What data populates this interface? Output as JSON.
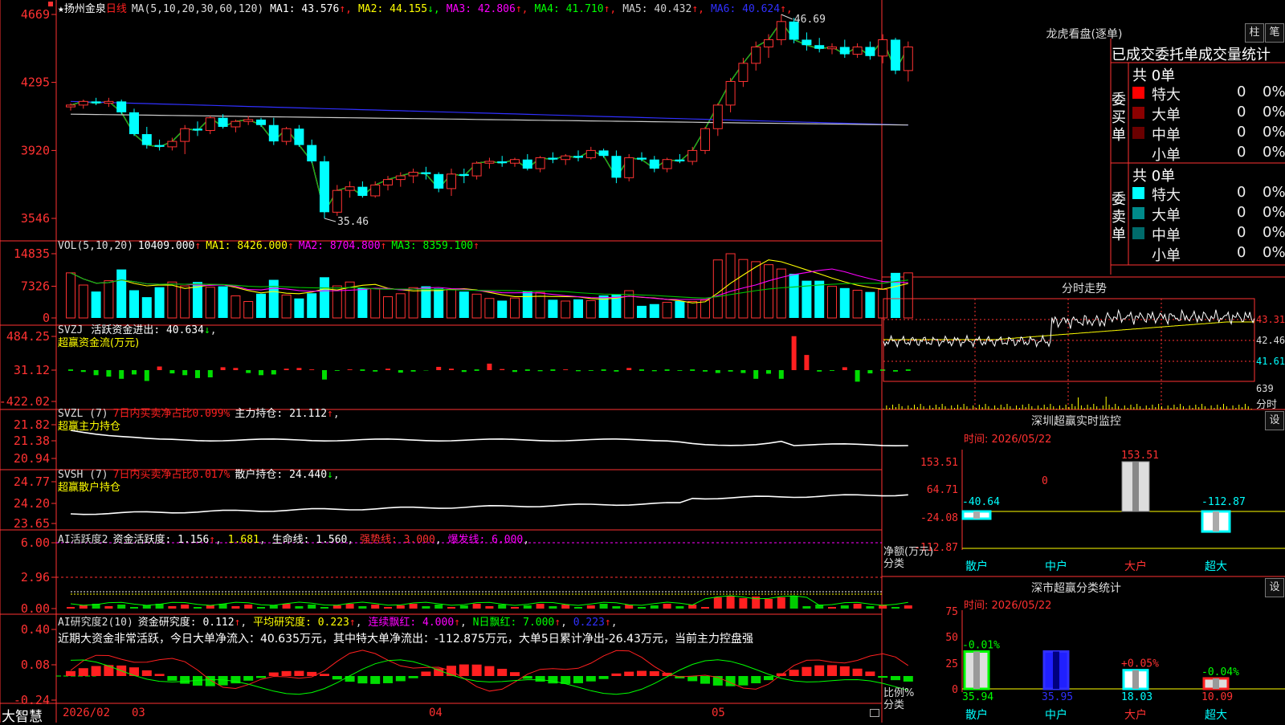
{
  "stock": {
    "star": "★",
    "name": "扬州金泉",
    "period": "日线"
  },
  "price_panel": {
    "ma_label": "MA(5,10,20,30,60,120)",
    "mas": [
      {
        "text": "MA1: 43.576",
        "arrow": "↑",
        "color": "#ffffff"
      },
      {
        "text": "MA2: 44.155",
        "arrow": "↓",
        "color": "#ffff00"
      },
      {
        "text": "MA3: 42.806",
        "arrow": "↑",
        "color": "#ff00ff"
      },
      {
        "text": "MA4: 41.710",
        "arrow": "↑",
        "color": "#00ff00"
      },
      {
        "text": "MA5: 40.432",
        "arrow": "↑",
        "color": "#d0d0d0"
      },
      {
        "text": "MA6: 40.624",
        "arrow": "↑",
        "color": "#3030ff"
      }
    ],
    "yticks": [
      "4669",
      "4295",
      "3920",
      "3546"
    ],
    "high_label": "46.69",
    "low_label": "35.46"
  },
  "vol_panel": {
    "label": "VOL(5,10,20)",
    "value": "10409.000",
    "v_arrow": "↑",
    "ma1": "MA1: 8426.000",
    "ma1_arrow": "↑",
    "ma2": "MA2: 8704.800",
    "ma2_arrow": "↑",
    "ma3": "MA3: 8359.100",
    "ma3_arrow": "↑",
    "yticks": [
      "14835",
      "7326",
      "0"
    ]
  },
  "svzj_panel": {
    "label": "SVZJ",
    "text1": "活跃资金进出: 40.634",
    "arrow": "↓",
    "text2": "超赢资金流(万元)",
    "yticks": [
      "484.25",
      "31.12",
      "-422.02"
    ]
  },
  "svzl_panel": {
    "label": "SVZL (7)",
    "text1": "7日内买卖净占比0.099%",
    "text2": "主力持仓: 21.112",
    "arrow": "↑",
    "text3": "超赢主力持仓",
    "yticks": [
      "21.82",
      "21.38",
      "20.94"
    ]
  },
  "svsh_panel": {
    "label": "SVSH (7)",
    "text1": "7日内买卖净占比0.017%",
    "text2": "散户持仓: 24.440",
    "arrow": "↓",
    "text3": "超赢散户持仓",
    "yticks": [
      "24.77",
      "24.20",
      "23.65"
    ]
  },
  "ai1_panel": {
    "label": "AI活跃度2",
    "text1": "资金活跃度: 1.156",
    "a1": "↑",
    "text2": "1.681",
    "text3": "生命线: 1.560",
    "text4": "强势线: 3.000",
    "text5": "爆发线: 6.000",
    "yticks": [
      "6.00",
      "2.96",
      "0.00"
    ]
  },
  "ai2_panel": {
    "label": "AI研究度2(10)",
    "text1": "资金研究度: 0.112",
    "a1": "↑",
    "text2": "平均研究度: 0.223",
    "a2": "↑",
    "text3": "连续飘红: 4.000",
    "a3": "↑",
    "text4": "N日飘红: 7.000",
    "a4": "↑",
    "text5": "0.223",
    "a5": "↑",
    "summary": "近期大资金非常活跃，今日大单净流入：40.635万元，其中特大单净流出：-112.875万元，大单5日累计净出-26.43万元，当前主力控盘强",
    "yticks": [
      "0.40",
      "0.08",
      "-0.24"
    ]
  },
  "footer": {
    "brand": "大智慧",
    "dates": [
      "2026/02",
      "03",
      "04",
      "05"
    ]
  },
  "dragon_tiger": {
    "title": "龙虎看盘(逐单)",
    "btn1": "柱",
    "btn2": "笔",
    "subtitle": "已成交委托单成交量统计",
    "buy_label": "委买单",
    "sell_label": "委卖单",
    "buy_total": "共 0单",
    "sell_total": "共 0单",
    "buy_rows": [
      {
        "name": "特大",
        "count": "0",
        "pct": "0%",
        "color": "#ff0000"
      },
      {
        "name": "大单",
        "count": "0",
        "pct": "0%",
        "color": "#8b0000"
      },
      {
        "name": "中单",
        "count": "0",
        "pct": "0%",
        "color": "#6a0000"
      },
      {
        "name": "小单",
        "count": "0",
        "pct": "0%",
        "color": "#000000"
      }
    ],
    "sell_rows": [
      {
        "name": "特大",
        "count": "0",
        "pct": "0%",
        "color": "#00ffff"
      },
      {
        "name": "大单",
        "count": "0",
        "pct": "0%",
        "color": "#008b8b"
      },
      {
        "name": "中单",
        "count": "0",
        "pct": "0%",
        "color": "#006b6b"
      },
      {
        "name": "小单",
        "count": "0",
        "pct": "0%",
        "color": "#000000"
      }
    ]
  },
  "intraday": {
    "title": "分时走势",
    "yticks": [
      "43.31",
      "42.46",
      "41.61"
    ],
    "vol_tick": "639",
    "x_label": "分时"
  },
  "monitor": {
    "title": "深圳超赢实时监控",
    "btn": "设",
    "time": "时间: 2026/05/22",
    "yticks": [
      "153.51",
      "64.71",
      "-24.08",
      "-112.87"
    ],
    "ylabel1": "净额(万元)",
    "ylabel2": "分类",
    "cats": [
      "散户",
      "中户",
      "大户",
      "超大"
    ],
    "values": [
      -40.64,
      0,
      153.51,
      -112.87
    ],
    "value_labels": [
      "-40.64",
      "0",
      "153.51",
      "-112.87"
    ]
  },
  "classify": {
    "title": "深市超赢分类统计",
    "btn": "设",
    "time": "时间: 2026/05/22",
    "yticks": [
      "75",
      "50",
      "25",
      "0"
    ],
    "ylabel1": "比例%",
    "ylabel2": "分类",
    "cats": [
      "散户",
      "中户",
      "大户",
      "超大"
    ],
    "values": [
      35.94,
      35.95,
      18.03,
      10.09
    ],
    "value_labels": [
      "35.94",
      "35.95",
      "18.03",
      "10.09"
    ],
    "change_labels": [
      "-0.01%",
      "",
      "+0.05%",
      "-0.04%"
    ]
  },
  "chart_data": {
    "type": "candlestick",
    "price_range": [
      35.46,
      46.69
    ],
    "candles": [
      [
        41.6,
        41.8,
        41.4,
        41.7
      ],
      [
        41.7,
        42.0,
        41.5,
        41.9
      ],
      [
        41.9,
        42.1,
        41.7,
        41.8
      ],
      [
        41.8,
        42.1,
        41.6,
        41.9
      ],
      [
        41.9,
        42.0,
        41.2,
        41.3
      ],
      [
        41.3,
        41.5,
        40.0,
        40.1
      ],
      [
        40.1,
        40.5,
        39.3,
        39.5
      ],
      [
        39.5,
        39.8,
        39.2,
        39.4
      ],
      [
        39.4,
        39.9,
        39.2,
        39.7
      ],
      [
        39.7,
        40.6,
        39.0,
        40.4
      ],
      [
        40.4,
        40.8,
        40.0,
        40.3
      ],
      [
        40.3,
        41.1,
        40.1,
        41.0
      ],
      [
        41.0,
        41.2,
        40.4,
        40.5
      ],
      [
        40.5,
        40.9,
        40.2,
        40.8
      ],
      [
        40.8,
        41.1,
        40.6,
        40.9
      ],
      [
        40.9,
        41.0,
        40.5,
        40.6
      ],
      [
        40.6,
        41.0,
        39.5,
        39.7
      ],
      [
        39.7,
        40.5,
        39.5,
        40.4
      ],
      [
        40.4,
        40.6,
        39.4,
        39.5
      ],
      [
        39.5,
        39.8,
        38.5,
        38.6
      ],
      [
        38.6,
        38.9,
        35.46,
        35.8
      ],
      [
        35.8,
        37.3,
        35.6,
        37.0
      ],
      [
        37.0,
        37.5,
        36.6,
        37.2
      ],
      [
        37.2,
        37.5,
        36.6,
        36.7
      ],
      [
        36.7,
        37.5,
        36.6,
        37.3
      ],
      [
        37.3,
        37.8,
        37.0,
        37.6
      ],
      [
        37.6,
        38.0,
        37.2,
        37.8
      ],
      [
        37.8,
        38.2,
        37.4,
        38.0
      ],
      [
        38.0,
        38.3,
        37.6,
        37.9
      ],
      [
        37.9,
        38.0,
        36.9,
        37.1
      ],
      [
        37.1,
        38.2,
        36.7,
        37.9
      ],
      [
        37.9,
        38.2,
        37.4,
        37.8
      ],
      [
        37.8,
        38.6,
        37.6,
        38.5
      ],
      [
        38.5,
        38.8,
        38.2,
        38.6
      ],
      [
        38.6,
        38.9,
        38.3,
        38.5
      ],
      [
        38.5,
        38.8,
        38.3,
        38.7
      ],
      [
        38.7,
        39.0,
        38.1,
        38.2
      ],
      [
        38.2,
        38.9,
        38.0,
        38.8
      ],
      [
        38.8,
        39.1,
        38.5,
        38.7
      ],
      [
        38.7,
        39.0,
        38.4,
        38.9
      ],
      [
        38.9,
        39.2,
        38.6,
        38.8
      ],
      [
        38.8,
        39.4,
        38.7,
        39.2
      ],
      [
        39.2,
        39.3,
        38.8,
        38.9
      ],
      [
        38.9,
        39.2,
        37.4,
        37.7
      ],
      [
        37.7,
        39.0,
        37.5,
        38.8
      ],
      [
        38.8,
        39.1,
        38.6,
        38.7
      ],
      [
        38.7,
        38.9,
        38.0,
        38.2
      ],
      [
        38.2,
        38.8,
        38.0,
        38.7
      ],
      [
        38.7,
        39.0,
        38.5,
        38.6
      ],
      [
        38.6,
        39.4,
        38.4,
        39.2
      ],
      [
        39.2,
        40.5,
        39.0,
        40.4
      ],
      [
        40.4,
        41.8,
        40.0,
        41.7
      ],
      [
        41.7,
        43.2,
        41.3,
        43.0
      ],
      [
        43.0,
        44.3,
        42.7,
        44.0
      ],
      [
        44.0,
        45.2,
        43.6,
        44.9
      ],
      [
        44.9,
        45.6,
        44.3,
        45.3
      ],
      [
        45.3,
        46.69,
        45.0,
        46.3
      ],
      [
        46.3,
        46.5,
        45.1,
        45.3
      ],
      [
        45.3,
        45.7,
        44.7,
        45.0
      ],
      [
        45.0,
        45.4,
        44.6,
        44.8
      ],
      [
        44.8,
        45.1,
        44.5,
        44.9
      ],
      [
        44.9,
        45.3,
        44.3,
        44.5
      ],
      [
        44.5,
        45.1,
        44.3,
        44.9
      ],
      [
        44.9,
        45.2,
        44.2,
        44.4
      ],
      [
        44.4,
        45.6,
        44.0,
        45.3
      ],
      [
        45.3,
        45.4,
        43.4,
        43.6
      ],
      [
        43.6,
        45.2,
        43.0,
        44.9
      ]
    ],
    "volume": [
      10409,
      7600,
      6100,
      8600,
      11200,
      6400,
      4800,
      7100,
      8300,
      7400,
      8300,
      7100,
      7300,
      5100,
      3800,
      5600,
      8800,
      5300,
      4500,
      5700,
      9400,
      7400,
      8300,
      6900,
      6800,
      4900,
      5600,
      7000,
      7300,
      6800,
      6600,
      6100,
      5500,
      4500,
      4000,
      4600,
      6100,
      5900,
      4200,
      3900,
      4300,
      4000,
      5200,
      5500,
      6300,
      2800,
      3200,
      3600,
      3900,
      3800,
      4100,
      13400,
      14835,
      13500,
      13000,
      12300,
      11300,
      10200,
      8600,
      8600,
      7300,
      6900,
      6400,
      6000,
      6600,
      10409,
      10409
    ],
    "svzj": [
      0,
      -25,
      -70,
      -90,
      -120,
      -60,
      -150,
      50,
      -45,
      -70,
      -110,
      -100,
      40,
      30,
      -40,
      -70,
      -60,
      20,
      30,
      10,
      -130,
      -10,
      10,
      0,
      -20,
      20,
      -35,
      -20,
      -5,
      45,
      20,
      -25,
      0,
      90,
      15,
      -25,
      0,
      -15,
      0,
      10,
      -15,
      -10,
      0,
      -20,
      30,
      0,
      -15,
      0,
      -10,
      0,
      -20,
      -40,
      -20,
      -40,
      -120,
      -50,
      -120,
      470,
      210,
      -20,
      -10,
      40,
      -160,
      -45,
      0,
      -20,
      0,
      -10,
      -50,
      150,
      20,
      10,
      -60,
      -45
    ]
  }
}
